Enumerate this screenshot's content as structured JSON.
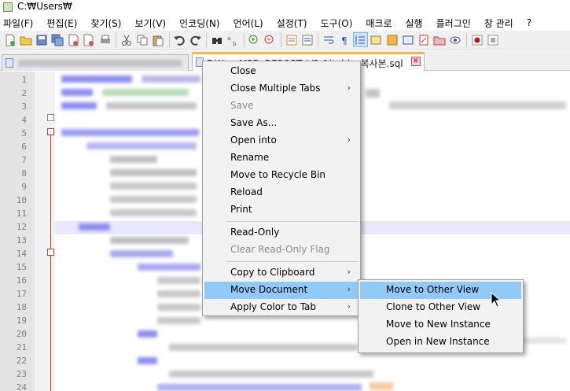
{
  "window": {
    "title": "C:₩Users₩"
  },
  "menubar": [
    "파일(F)",
    "편집(E)",
    "찾기(S)",
    "보기(V)",
    "인코딩(N)",
    "언어(L)",
    "설정(T)",
    "도구(O)",
    "매크로",
    "실행",
    "플러그인",
    "창 관리",
    "?"
  ],
  "toolbar": {
    "icons": [
      "new-file-icon",
      "open-file-icon",
      "save-icon",
      "save-all-icon",
      "close-icon",
      "close-all-icon",
      "print-icon",
      "cut-icon",
      "copy-icon",
      "paste-icon",
      "undo-icon",
      "redo-icon",
      "find-icon",
      "replace-icon",
      "zoom-in-icon",
      "zoom-out-icon",
      "sync-vertical-icon",
      "sync-horizontal-icon",
      "word-wrap-icon",
      "show-all-chars-icon",
      "indent-guide-icon",
      "doc-map-icon",
      "function-list-icon",
      "folder-workspace-icon",
      "doc-list-icon",
      "monitoring-icon",
      "record-macro-icon",
      "stop-macro-icon"
    ]
  },
  "tabs": [
    {
      "label": ""
    },
    {
      "label": "F:₩ ... MPD_REPORT_V2.0(tab) - 복사본.sql",
      "active": true
    }
  ],
  "editor": {
    "line_numbers": [
      "1",
      "2",
      "3",
      "4",
      "5",
      "6",
      "7",
      "8",
      "9",
      "10",
      "11",
      "12",
      "13",
      "14",
      "15",
      "16",
      "17",
      "18",
      "19",
      "20",
      "21",
      "22",
      "23",
      "24"
    ],
    "colors": {
      "fold_line": "#e0302a",
      "current_line": "#e8e8ff"
    }
  },
  "context_menu": {
    "items": [
      {
        "label": "Close"
      },
      {
        "label": "Close Multiple Tabs",
        "submenu": true
      },
      {
        "label": "Save",
        "disabled": true
      },
      {
        "label": "Save As..."
      },
      {
        "label": "Open into",
        "submenu": true
      },
      {
        "label": "Rename"
      },
      {
        "label": "Move to Recycle Bin"
      },
      {
        "label": "Reload"
      },
      {
        "label": "Print"
      },
      {
        "label": "Read-Only"
      },
      {
        "label": "Clear Read-Only Flag",
        "disabled": true
      },
      {
        "label": "Copy to Clipboard",
        "submenu": true
      },
      {
        "label": "Move Document",
        "submenu": true,
        "highlighted": true
      },
      {
        "label": "Apply Color to Tab",
        "submenu": true
      }
    ],
    "submenu_arrow": "›"
  },
  "submenu": {
    "items": [
      {
        "label": "Move to Other View",
        "highlighted": true
      },
      {
        "label": "Clone to Other View"
      },
      {
        "label": "Move to New Instance"
      },
      {
        "label": "Open in New Instance"
      }
    ]
  },
  "accent_colors": {
    "menu_highlight": "#91c9f7",
    "active_tab_top": "#ffb347"
  }
}
